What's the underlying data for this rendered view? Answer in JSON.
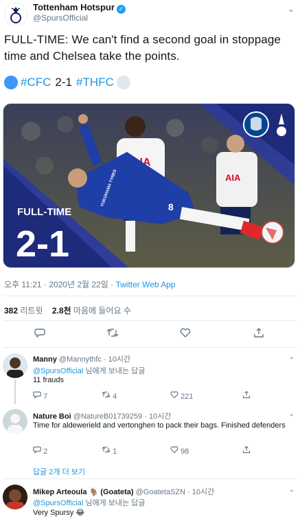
{
  "tweet": {
    "author_name": "Tottenham Hotspur",
    "author_handle": "@SpursOfficial",
    "text": "FULL-TIME: We can't find a second goal in stoppage time and Chelsea take the points.",
    "score_left_tag": "#CFC",
    "score": "2-1",
    "score_right_tag": "#THFC",
    "media": {
      "label": "FULL-TIME",
      "score": "2-1",
      "shirt_sponsor_1": "AIA",
      "shirt_sponsor_2": "AIA",
      "shirt_number": "8",
      "sponsor_text": "YOKOHAMA TYRES"
    },
    "time": "오후 11:21",
    "date": "2020년 2월 22일",
    "separator": "·",
    "via": "Twitter Web App",
    "retweets": "382",
    "retweets_label": "리트윗",
    "likes": "2.8천",
    "likes_label": "마음에 들어요 수"
  },
  "replies": [
    {
      "name": "Manny",
      "handle": "@Mannythfc",
      "time": "10시간",
      "to_handle": "@SpursOfficial",
      "to_label": "님에게 보내는 답글",
      "text": "11 frauds",
      "reply_count": "7",
      "retweet_count": "4",
      "like_count": "221"
    },
    {
      "name": "Nature Boi",
      "handle": "@NatureB01739259",
      "time": "10시간",
      "text": "Time for aldewerield and vertonghen to pack their bags. Finished defenders",
      "reply_count": "2",
      "retweet_count": "1",
      "like_count": "98"
    },
    {
      "name": "Mikep Arteoula",
      "name_emoji": "🐐",
      "name_suffix": "(Goateta)",
      "handle": "@GoatetaSZN",
      "time": "10시간",
      "to_handle": "@SpursOfficial",
      "to_label": "님에게 보내는 답글",
      "text": "Very Spursy",
      "text_emoji": "😂"
    }
  ],
  "show_more": "답글 2개 더 보기",
  "colors": {
    "chelsea_blue": "#1b8ee6",
    "spurs_grey": "#e1e8ed",
    "link": "#1b95e0",
    "media_navy": "#1e2a66"
  }
}
